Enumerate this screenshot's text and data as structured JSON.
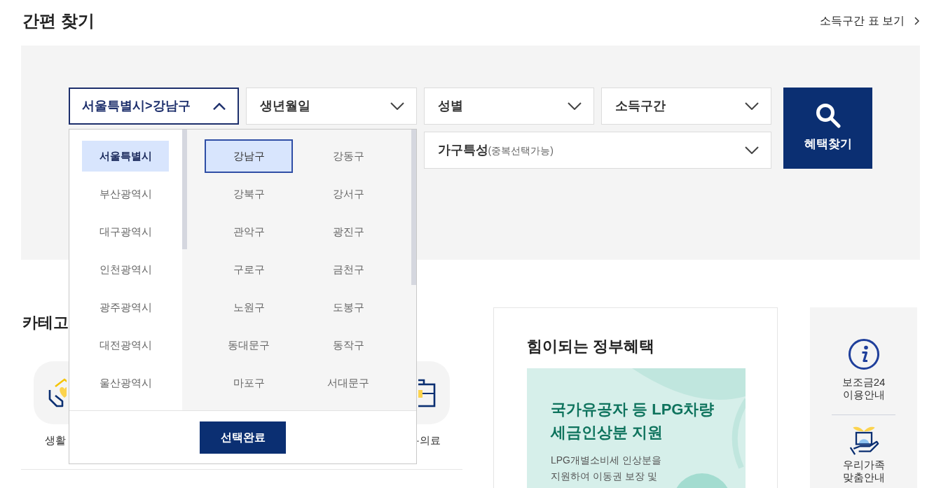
{
  "header": {
    "title": "간편 찾기",
    "link": "소득구간 표 보기"
  },
  "filters": [
    {
      "label": "서울특별시>강남구",
      "expanded": true,
      "dropdown": {
        "provinces": [
          {
            "label": "서울특별시",
            "selected": true
          },
          {
            "label": "부산광역시",
            "selected": false
          },
          {
            "label": "대구광역시",
            "selected": false
          },
          {
            "label": "인천광역시",
            "selected": false
          },
          {
            "label": "광주광역시",
            "selected": false
          },
          {
            "label": "대전광역시",
            "selected": false
          },
          {
            "label": "울산광역시",
            "selected": false
          }
        ],
        "districts": [
          {
            "label": "강남구",
            "selected": true
          },
          {
            "label": "강동구",
            "selected": false
          },
          {
            "label": "강북구",
            "selected": false
          },
          {
            "label": "강서구",
            "selected": false
          },
          {
            "label": "관악구",
            "selected": false
          },
          {
            "label": "광진구",
            "selected": false
          },
          {
            "label": "구로구",
            "selected": false
          },
          {
            "label": "금천구",
            "selected": false
          },
          {
            "label": "노원구",
            "selected": false
          },
          {
            "label": "도봉구",
            "selected": false
          },
          {
            "label": "동대문구",
            "selected": false
          },
          {
            "label": "동작구",
            "selected": false
          },
          {
            "label": "마포구",
            "selected": false
          },
          {
            "label": "서대문구",
            "selected": false
          }
        ],
        "confirm_button": "선택완료"
      }
    },
    {
      "label": "생년월일",
      "expanded": false
    },
    {
      "label": "성별",
      "expanded": false
    },
    {
      "label": "소득구간",
      "expanded": false
    },
    {
      "label": "가구특성",
      "note": "(중복선택가능)",
      "expanded": false
    }
  ],
  "search_button": "혜택찾기",
  "category": {
    "heading": "카테고",
    "items": [
      {
        "label": "생활"
      },
      {
        "label": "·의료"
      }
    ]
  },
  "benefits": {
    "title": "힘이되는 정부혜택",
    "banner": {
      "headline": [
        "국가유공자 등 LPG차량",
        "세금인상분 지원"
      ],
      "description": [
        "LPG개별소비세 인상분을",
        "지원하여 이동권 보장 및"
      ]
    }
  },
  "side_menu": [
    {
      "label": [
        "보조금24",
        "이용안내"
      ]
    },
    {
      "label": [
        "우리가족",
        "맞춤안내"
      ]
    }
  ]
}
